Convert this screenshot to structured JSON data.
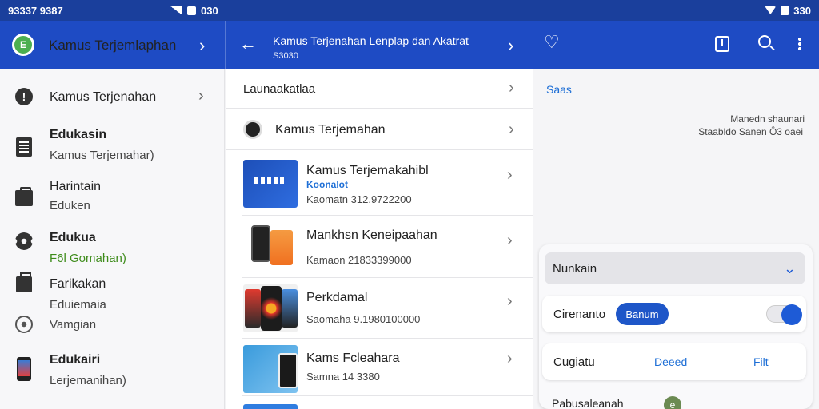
{
  "statusbar": {
    "time": "93337 9387",
    "mid_text": "030",
    "right_text": "330"
  },
  "header": {
    "logo_text": "E",
    "app_title": "Kamus Terjemlaphan",
    "detail_title": "Kamus Terjenahan Lenplap dan Akatrat",
    "detail_sub": "S3030"
  },
  "sidebar": {
    "items": [
      {
        "title": "Kamus Terjenahan",
        "sub": "",
        "icon": "alert-icon"
      },
      {
        "title": "Edukasin",
        "sub": "Kamus Terjemahar)",
        "icon": "document-icon"
      },
      {
        "title": "Harintain",
        "sub": "Eduken",
        "icon": "briefcase-icon"
      },
      {
        "title": "Edukua",
        "sub": "F6l Gomahan)",
        "icon": "gear-icon"
      },
      {
        "title": "Farikakan",
        "sub": "Eduiemaia",
        "icon": "bag-icon"
      },
      {
        "title": "",
        "sub": "Vamgian",
        "icon": "disc-icon"
      },
      {
        "title": "Edukairi",
        "sub": "Ŀerjemanihan)",
        "icon": "phone-icon"
      }
    ]
  },
  "main": {
    "section_label": "Launaakatlaa",
    "first_row": "Kamus Terjemahan",
    "apps": [
      {
        "title": "Kamus Terjemakahibl",
        "sub": "Koonalot",
        "meta": "Kaomatn 312.9722200"
      },
      {
        "title": "Mankhsn Keneipaahan",
        "sub": "",
        "meta": "Kamaon 21833399000"
      },
      {
        "title": "Perkdamal",
        "sub": "",
        "meta": "Saomaha 9.1980100000"
      },
      {
        "title": "Kams Fcleahara",
        "sub": "",
        "meta": "Samna 14 3380"
      }
    ]
  },
  "right": {
    "tab_label": "Saas",
    "meta_line1": "Manedn shaunari",
    "meta_line2": "Staabldo Sanen  Ô3 oaei",
    "dropdown_label": "Nunkain",
    "row1_label": "Cirenanto",
    "row1_chip": "Banum",
    "toggle_on": true,
    "row2_label": "Cugiatu",
    "row2_action1": "Deeed",
    "row2_action2": "Filt",
    "row3_label": "Pabusaleanah",
    "accent_color": "#1e56c8"
  }
}
